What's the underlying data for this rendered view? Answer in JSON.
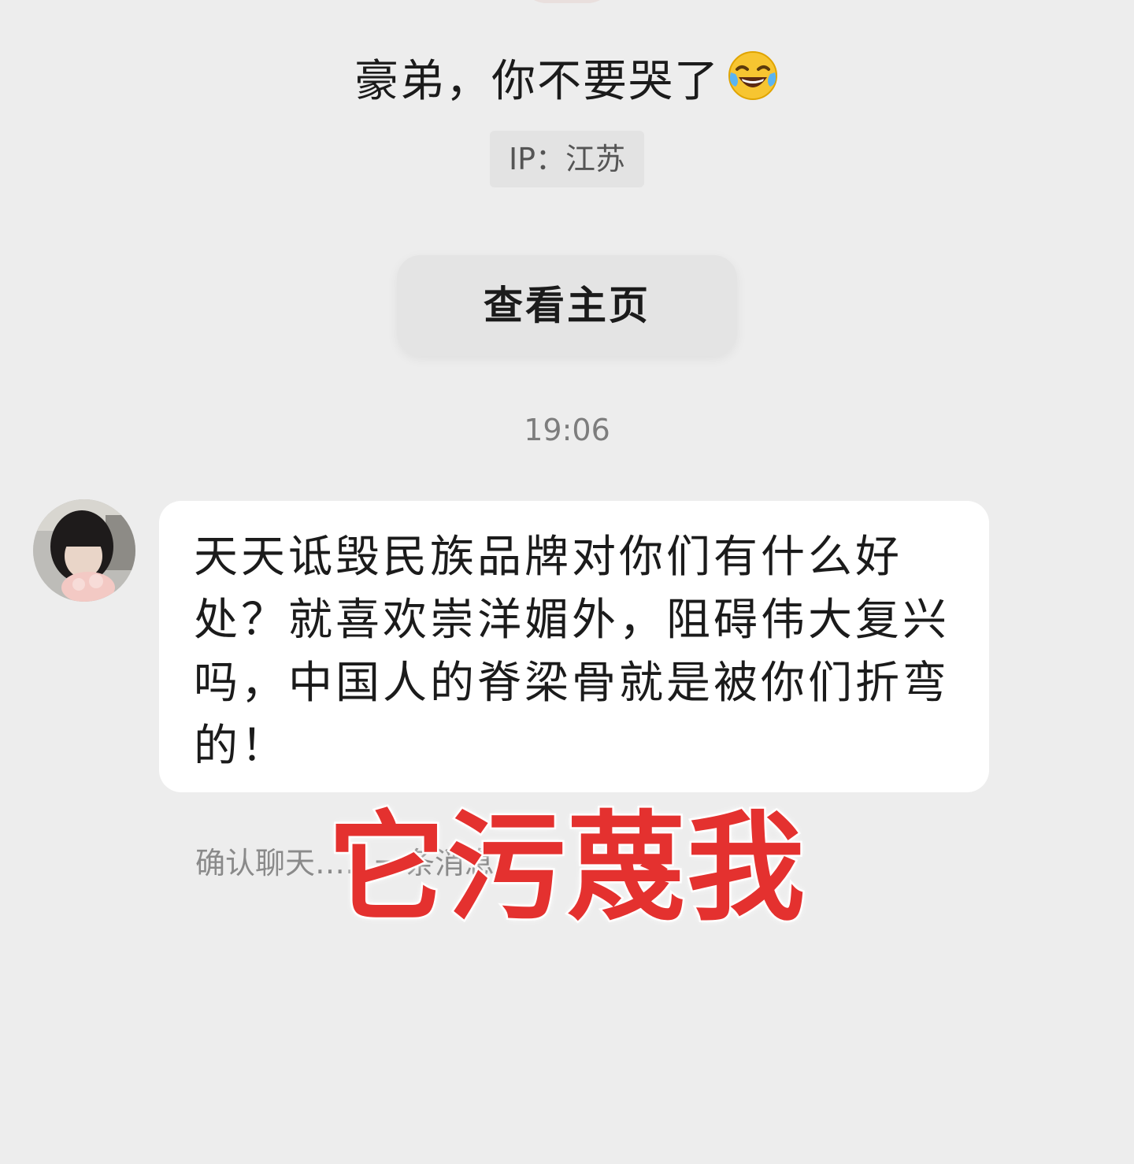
{
  "profile": {
    "name": "豪弟，你不要哭了",
    "name_emoji": "face-with-tears-of-joy-icon",
    "ip_label": "IP：江苏",
    "view_profile_label": "查看主页"
  },
  "chat": {
    "timestamp": "19:06",
    "messages": [
      {
        "sender": "other",
        "avatar": "avatar",
        "text": "天天诋毁民族品牌对你们有什么好处？就喜欢崇洋媚外，阻碍伟大复兴吗，中国人的脊梁骨就是被你们折弯的！"
      }
    ],
    "system_note": "确认聊天……一条消息"
  },
  "overlay": {
    "caption": "它污蔑我",
    "color": "#e4312f"
  },
  "colors": {
    "background": "#ededed",
    "bubble": "#ffffff",
    "button": "#e4e4e4",
    "muted_text": "#7d7d7d"
  }
}
